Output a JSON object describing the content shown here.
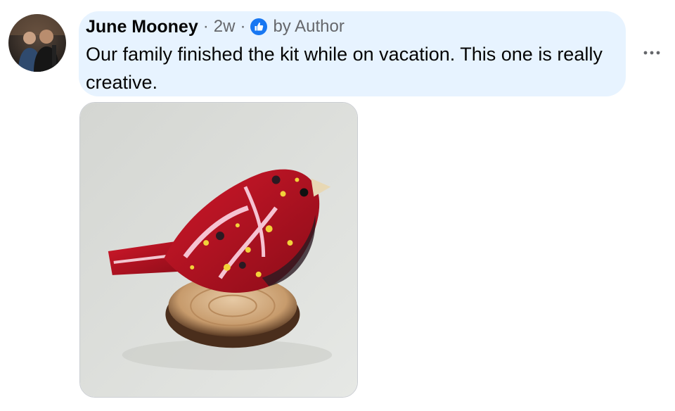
{
  "comment": {
    "author": "June Mooney",
    "separator": "·",
    "timestamp": "2w",
    "badge_label": "by Author",
    "text": "Our family finished the kit while on vacation. This one is really creative.",
    "badge_icon": "thumbs-up-icon",
    "more_icon": "more-options-icon",
    "accent_color": "#1877f2",
    "bubble_color": "#e7f3ff"
  }
}
